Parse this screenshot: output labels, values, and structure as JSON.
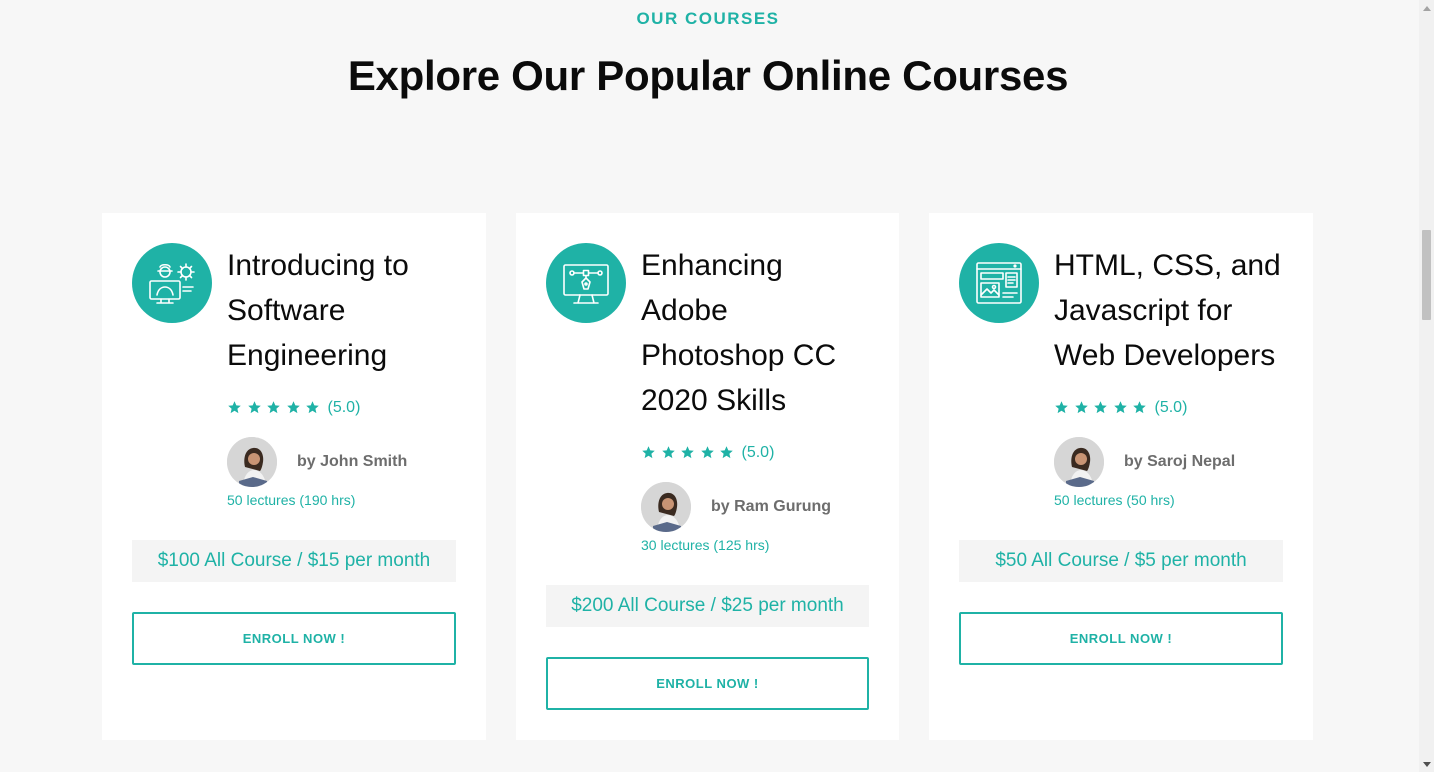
{
  "section": {
    "eyebrow": "OUR COURSES",
    "headline": "Explore Our Popular Online Courses"
  },
  "colors": {
    "accent": "#1fb2a6",
    "background": "#f7f7f7",
    "card": "#ffffff",
    "price_bg": "#f4f4f4"
  },
  "courses": [
    {
      "icon": "engineer-monitor-gear-icon",
      "title_lines": [
        "Introducing to",
        "Software",
        "Engineering"
      ],
      "rating_stars": 5,
      "rating_text": "(5.0)",
      "author": "by John Smith",
      "lectures": "50 lectures (190 hrs)",
      "price": "$100 All Course / $15 per month",
      "enroll": "ENROLL NOW !"
    },
    {
      "icon": "design-monitor-pen-icon",
      "title_lines": [
        "Enhancing",
        "Adobe",
        "Photoshop CC",
        "2020 Skills"
      ],
      "rating_stars": 5,
      "rating_text": "(5.0)",
      "author": "by Ram Gurung",
      "lectures": "30 lectures (125 hrs)",
      "price": "$200 All Course / $25 per month",
      "enroll": "ENROLL NOW !"
    },
    {
      "icon": "web-layout-browser-icon",
      "title_lines": [
        "HTML, CSS, and",
        "Javascript for",
        "Web Developers"
      ],
      "rating_stars": 5,
      "rating_text": "(5.0)",
      "author": "by Saroj Nepal",
      "lectures": "50 lectures (50 hrs)",
      "price": "$50 All Course / $5 per month",
      "enroll": "ENROLL NOW !"
    }
  ]
}
